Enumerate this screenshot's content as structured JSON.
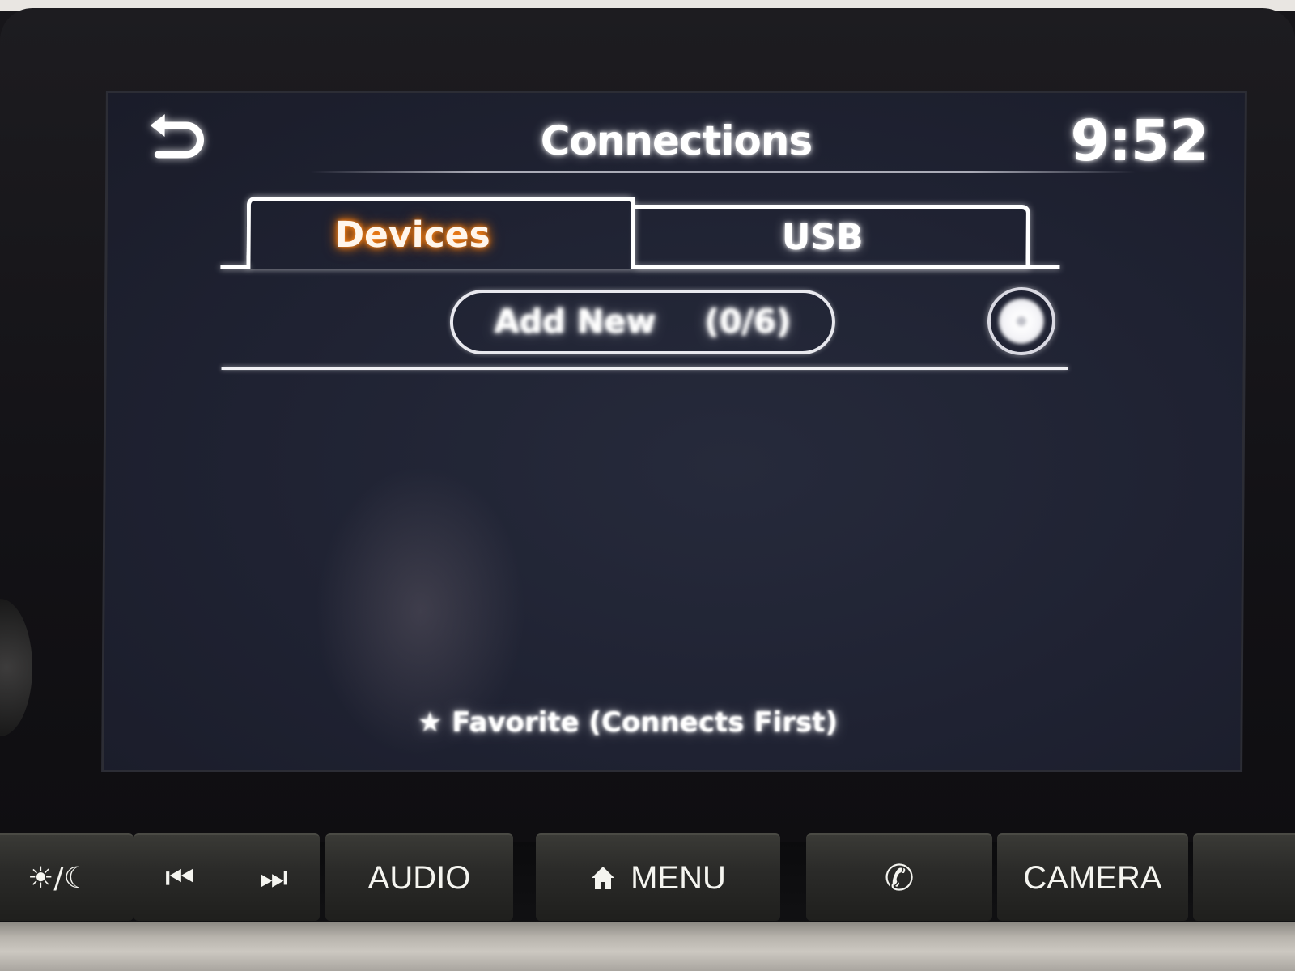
{
  "screen": {
    "title": "Connections",
    "clock": "9:52",
    "back_icon": "back-arrow-icon",
    "tabs": [
      {
        "label": "Devices",
        "active": true
      },
      {
        "label": "USB",
        "active": false
      }
    ],
    "add_new": {
      "label": "Add New",
      "count": "(0/6)"
    },
    "settings_icon": "settings-gear-icon",
    "footer_note": "★ Favorite (Connects First)",
    "accent_color": "#ff8a1f"
  },
  "hardware_buttons": [
    {
      "id": "day-night",
      "icon": "sun-moon-icon",
      "label": "☀/☾"
    },
    {
      "id": "track",
      "icons": [
        "previous-track-icon",
        "next-track-icon"
      ],
      "labels": [
        "⏮",
        "⏭"
      ]
    },
    {
      "id": "audio",
      "label": "AUDIO"
    },
    {
      "id": "menu",
      "icon": "home-icon",
      "label": "MENU"
    },
    {
      "id": "phone",
      "icon": "phone-icon",
      "label": "✆"
    },
    {
      "id": "camera",
      "label": "CAMERA"
    }
  ]
}
